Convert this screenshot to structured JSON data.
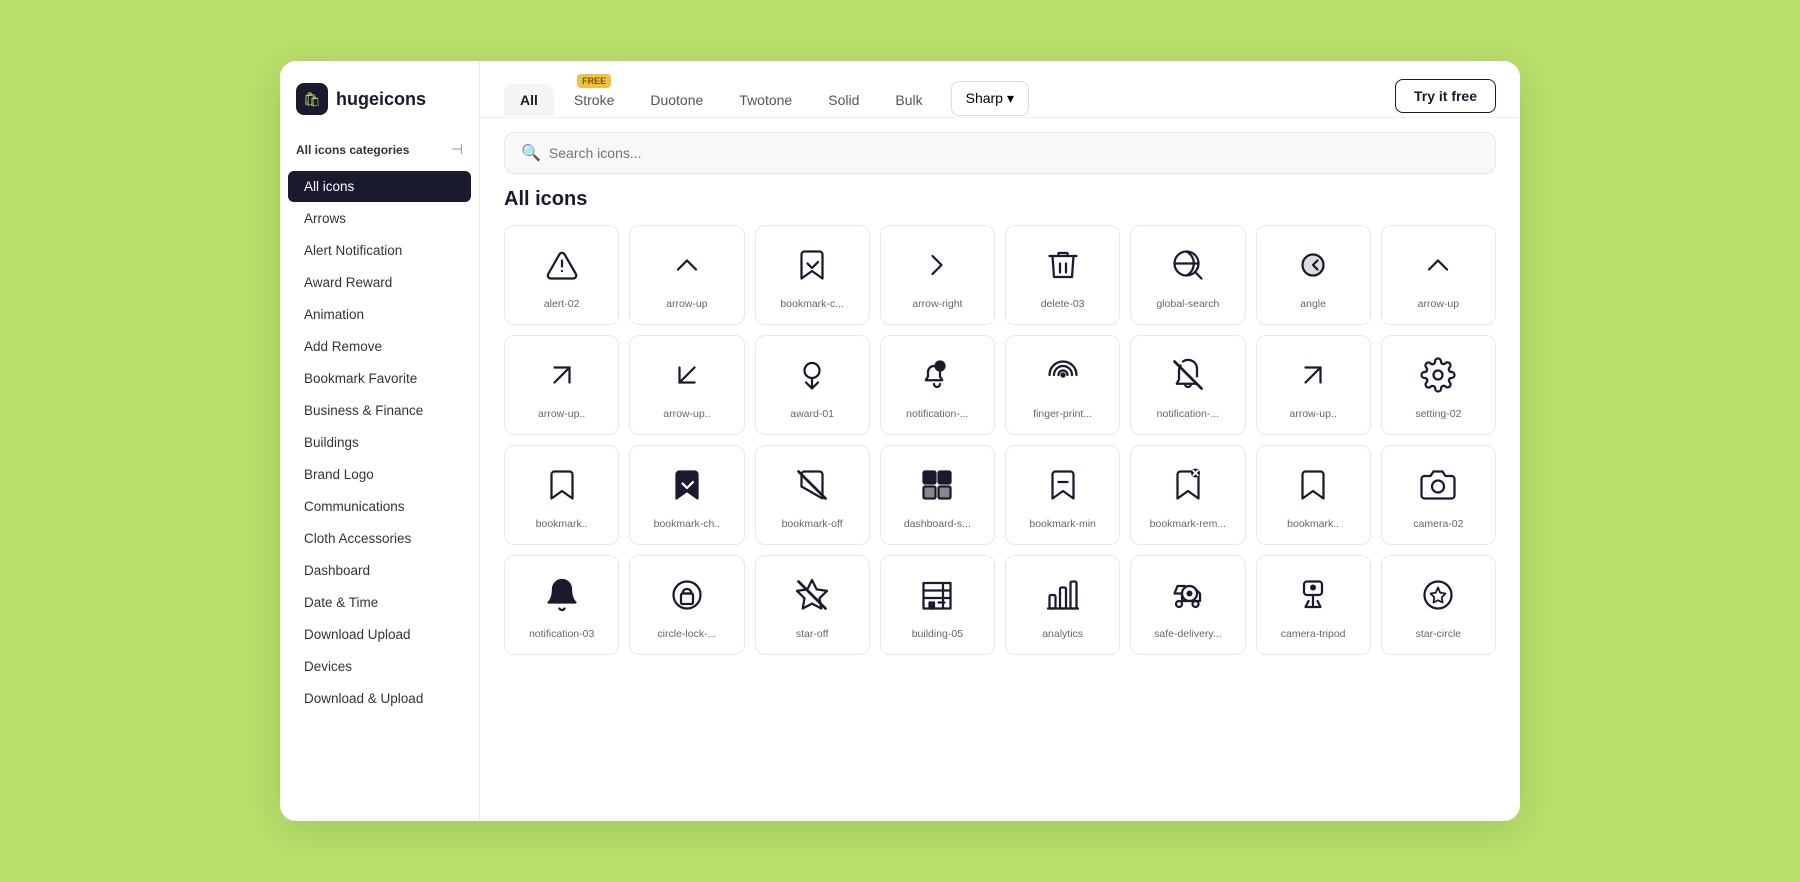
{
  "logo": {
    "icon": "🛍",
    "text": "hugeicons"
  },
  "sidebar": {
    "section_title": "All icons categories",
    "items": [
      {
        "label": "All icons",
        "active": true
      },
      {
        "label": "Arrows",
        "active": false
      },
      {
        "label": "Alert Notification",
        "active": false
      },
      {
        "label": "Award Reward",
        "active": false
      },
      {
        "label": "Animation",
        "active": false
      },
      {
        "label": "Add Remove",
        "active": false
      },
      {
        "label": "Bookmark Favorite",
        "active": false
      },
      {
        "label": "Business & Finance",
        "active": false
      },
      {
        "label": "Buildings",
        "active": false
      },
      {
        "label": "Brand Logo",
        "active": false
      },
      {
        "label": "Communications",
        "active": false
      },
      {
        "label": "Cloth Accessories",
        "active": false
      },
      {
        "label": "Dashboard",
        "active": false
      },
      {
        "label": "Date & Time",
        "active": false
      },
      {
        "label": "Download Upload",
        "active": false
      },
      {
        "label": "Devices",
        "active": false
      },
      {
        "label": "Download & Upload",
        "active": false
      }
    ]
  },
  "tabs": [
    {
      "label": "All",
      "active": true,
      "free": false
    },
    {
      "label": "Stroke",
      "active": false,
      "free": true
    },
    {
      "label": "Duotone",
      "active": false,
      "free": false
    },
    {
      "label": "Twotone",
      "active": false,
      "free": false
    },
    {
      "label": "Solid",
      "active": false,
      "free": false
    },
    {
      "label": "Bulk",
      "active": false,
      "free": false
    }
  ],
  "sharp_label": "Sharp",
  "try_free_label": "Try it free",
  "search_placeholder": "Search icons...",
  "section_title": "All icons",
  "icons": [
    {
      "label": "alert-02"
    },
    {
      "label": "arrow-up"
    },
    {
      "label": "bookmark-c..."
    },
    {
      "label": "arrow-right"
    },
    {
      "label": "delete-03"
    },
    {
      "label": "global-search"
    },
    {
      "label": "angle"
    },
    {
      "label": "arrow-up"
    },
    {
      "label": "arrow-up.."
    },
    {
      "label": "arrow-up.."
    },
    {
      "label": "award-01"
    },
    {
      "label": "notification-..."
    },
    {
      "label": "finger-print..."
    },
    {
      "label": "notification-..."
    },
    {
      "label": "arrow-up.."
    },
    {
      "label": "setting-02"
    },
    {
      "label": "bookmark.."
    },
    {
      "label": "bookmark-ch.."
    },
    {
      "label": "bookmark-off"
    },
    {
      "label": "dashboard-s..."
    },
    {
      "label": "bookmark-min"
    },
    {
      "label": "bookmark-rem..."
    },
    {
      "label": "bookmark.."
    },
    {
      "label": "camera-02"
    },
    {
      "label": "notification-03"
    },
    {
      "label": "circle-lock-..."
    },
    {
      "label": "star-off"
    },
    {
      "label": "building-05"
    },
    {
      "label": "analytics"
    },
    {
      "label": "safe-delivery..."
    },
    {
      "label": "camera-tripod"
    },
    {
      "label": "star-circle"
    }
  ]
}
